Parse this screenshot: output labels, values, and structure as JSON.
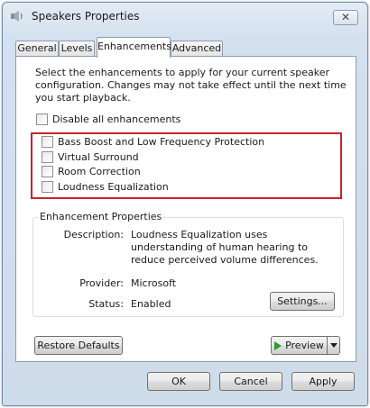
{
  "window": {
    "title": "Speakers Properties",
    "close_glyph": "✕"
  },
  "tabs": [
    {
      "label": "General"
    },
    {
      "label": "Levels"
    },
    {
      "label": "Enhancements"
    },
    {
      "label": "Advanced"
    }
  ],
  "panel": {
    "intro": "Select the enhancements to apply for your current speaker configuration. Changes may not take effect until the next time you start playback.",
    "disable_all": "Disable all enhancements",
    "enhancements": [
      {
        "label": "Bass Boost and Low Frequency Protection",
        "checked": false
      },
      {
        "label": "Virtual Surround",
        "checked": false
      },
      {
        "label": "Room Correction",
        "checked": false
      },
      {
        "label": "Loudness Equalization",
        "checked": false
      }
    ],
    "properties": {
      "title": "Enhancement Properties",
      "description_label": "Description:",
      "description": "Loudness Equalization uses understanding of human hearing to reduce perceived volume differences.",
      "provider_label": "Provider:",
      "provider": "Microsoft",
      "status_label": "Status:",
      "status": "Enabled",
      "settings_button": "Settings..."
    },
    "restore_defaults": "Restore Defaults",
    "preview": "Preview"
  },
  "footer": {
    "ok": "OK",
    "cancel": "Cancel",
    "apply": "Apply"
  },
  "colors": {
    "highlight_border": "#c9232c",
    "play_icon": "#2e9b2e"
  }
}
